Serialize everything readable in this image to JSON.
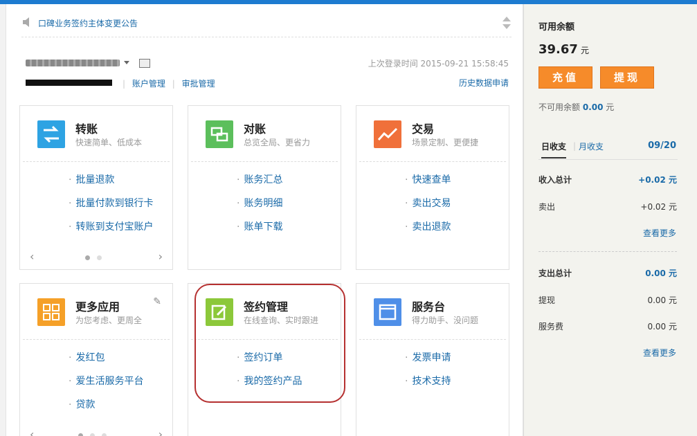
{
  "notice": {
    "text": "口碑业务签约主体变更公告",
    "icon": "speaker-icon"
  },
  "account": {
    "last_login": "上次登录时间 2015-09-21 15:58:45",
    "links": [
      "账户管理",
      "审批管理"
    ],
    "history": "历史数据申请"
  },
  "cards": [
    {
      "title": "转账",
      "sub": "快速简单、低成本",
      "icon": "transfer-icon",
      "color": "#2ea3e3",
      "items": [
        "批量退款",
        "批量付款到银行卡",
        "转账到支付宝账户"
      ]
    },
    {
      "title": "对账",
      "sub": "总览全局、更省力",
      "icon": "reconcile-icon",
      "color": "#5cbf5c",
      "items": [
        "账务汇总",
        "账务明细",
        "账单下载"
      ]
    },
    {
      "title": "交易",
      "sub": "场景定制、更便捷",
      "icon": "trade-chart-icon",
      "color": "#f0703a",
      "items": [
        "快速查单",
        "卖出交易",
        "卖出退款"
      ]
    },
    {
      "title": "更多应用",
      "sub": "为您考虑、更周全",
      "icon": "grid-apps-icon",
      "color": "#f5a028",
      "items": [
        "发红包",
        "爱生活服务平台",
        "贷款"
      ]
    },
    {
      "title": "签约管理",
      "sub": "在线查询、实时跟进",
      "icon": "sign-edit-icon",
      "color": "#8cc83a",
      "items": [
        "签约订单",
        "我的签约产品"
      ]
    },
    {
      "title": "服务台",
      "sub": "得力助手、没问题",
      "icon": "service-window-icon",
      "color": "#4f8fe8",
      "items": [
        "发票申请",
        "技术支持"
      ]
    }
  ],
  "side": {
    "label": "可用余额",
    "balance": "39.67",
    "unit": "元",
    "recharge": "充值",
    "withdraw": "提现",
    "unavail_label": "不可用余额",
    "unavail_value": "0.00",
    "tab_day": "日收支",
    "tab_month": "月收支",
    "date": "09/20",
    "income_total_label": "收入总计",
    "income_total": "+0.02 元",
    "sell_label": "卖出",
    "sell_value": "+0.02 元",
    "more": "查看更多",
    "expense_total_label": "支出总计",
    "expense_total": "0.00 元",
    "withdraw_label": "提现",
    "withdraw_value": "0.00 元",
    "fee_label": "服务费",
    "fee_value": "0.00 元"
  }
}
